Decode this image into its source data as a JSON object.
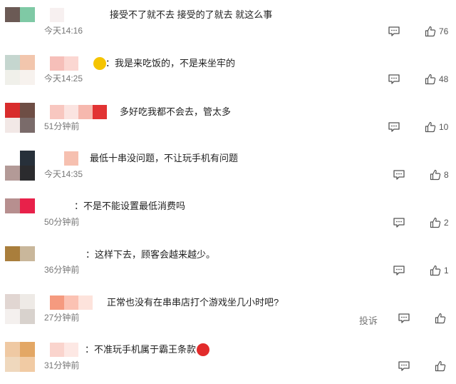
{
  "comments": [
    {
      "text": "接受不了就不去 接受的了就去 就这么事",
      "time": "今天14:16",
      "likes": "76",
      "avatar": [
        "#6b5a55",
        "#7fc9a5",
        "#ffffff",
        "#ffffff"
      ],
      "name_colors": [
        "#f7f0f0"
      ]
    },
    {
      "text": "：我是来吃饭的，不是来坐牢的",
      "time": "今天14:25",
      "likes": "48",
      "avatar": [
        "#c5d6cf",
        "#f2c6ad",
        "#f0f0ea",
        "#f7f2ee"
      ],
      "name_colors": [
        "#f6bfb9",
        "#fbd7d2"
      ],
      "sticker_color": "#f5c400"
    },
    {
      "text": "多好吃我都不会去，管太多",
      "time": "51分钟前",
      "likes": "10",
      "avatar": [
        "#d82c2c",
        "#6e4e45",
        "#f2e8e6",
        "#7a6b6a"
      ],
      "name_colors": [
        "#f8c7c0",
        "#fbe4e1",
        "#f6b8ae",
        "#e23333"
      ]
    },
    {
      "text": "最低十串没问题，不让玩手机有问题",
      "time": "今天14:35",
      "likes": "8",
      "avatar": [
        "#ffffff",
        "#27303a",
        "#b39a97",
        "#2b2b2e"
      ],
      "name_colors": [
        "#f6c0b0"
      ]
    },
    {
      "text": "：不是不能设置最低消费吗",
      "time": "50分钟前",
      "likes": "2",
      "avatar": [
        "#b78f8f",
        "#e8214a",
        "#ffffff",
        "#ffffff"
      ],
      "name_colors": []
    },
    {
      "text": "：这样下去，顾客会越来越少。",
      "time": "36分钟前",
      "likes": "1",
      "avatar": [
        "#a97e3c",
        "#c9b79b",
        "#ffffff",
        "#ffffff"
      ],
      "name_colors": []
    },
    {
      "text": "正常也没有在串串店打个游戏坐几小时吧?",
      "time": "27分钟前",
      "likes": "",
      "avatar": [
        "#e1d6d2",
        "#eeeae6",
        "#f4f0ee",
        "#d8d2cd"
      ],
      "name_colors": [
        "#f59a7f",
        "#fbc2b3",
        "#fde3dc"
      ],
      "report": "投诉"
    },
    {
      "text": "：不准玩手机属于霸王条款",
      "time": "31分钟前",
      "likes": "",
      "avatar": [
        "#efc9a3",
        "#e3a765",
        "#efd8bd",
        "#f1cba4"
      ],
      "name_colors": [
        "#fad4cd",
        "#fde8e4"
      ],
      "sticker_color": "#e22b2b"
    }
  ]
}
